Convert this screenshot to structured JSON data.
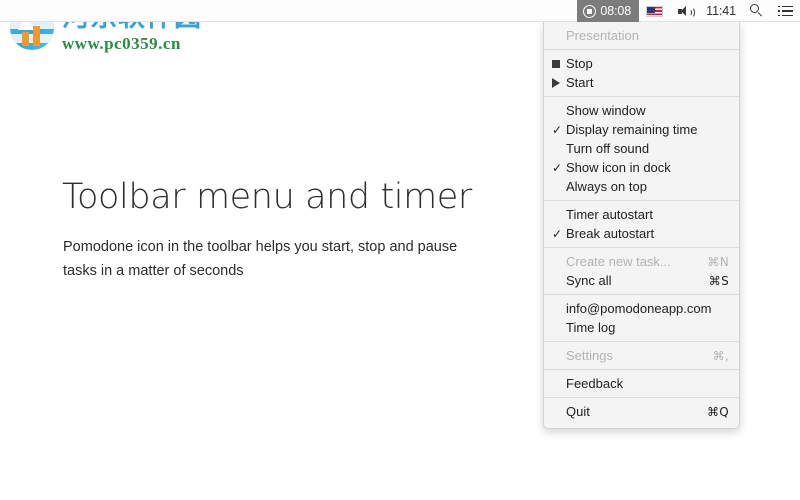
{
  "menubar": {
    "pomodone": {
      "icon": "pomodone-timer-icon",
      "time": "08:08"
    },
    "language_flag": "us-flag-icon",
    "volume_icon": "speaker-icon",
    "clock": "11:41",
    "search_icon": "search-icon",
    "control_center_icon": "list-menu-icon"
  },
  "watermark": {
    "site_name": "河东软件园",
    "url": "www.pc0359.cn"
  },
  "content": {
    "headline": "Toolbar menu and timer",
    "subline": "Pomodone icon in the toolbar helps you start, stop and pause tasks in a matter of seconds"
  },
  "dropdown": {
    "groups": [
      {
        "items": [
          {
            "label": "Presentation",
            "mark": "",
            "glyph": "",
            "shortcut": "",
            "disabled": true
          }
        ]
      },
      {
        "items": [
          {
            "label": "Stop",
            "mark": "",
            "glyph": "square",
            "shortcut": "",
            "disabled": false
          },
          {
            "label": "Start",
            "mark": "",
            "glyph": "triangle",
            "shortcut": "",
            "disabled": false
          }
        ]
      },
      {
        "items": [
          {
            "label": "Show window",
            "mark": "",
            "glyph": "",
            "shortcut": "",
            "disabled": false
          },
          {
            "label": "Display remaining time",
            "mark": "✓",
            "glyph": "",
            "shortcut": "",
            "disabled": false
          },
          {
            "label": "Turn off sound",
            "mark": "",
            "glyph": "",
            "shortcut": "",
            "disabled": false
          },
          {
            "label": "Show icon in dock",
            "mark": "✓",
            "glyph": "",
            "shortcut": "",
            "disabled": false
          },
          {
            "label": "Always on top",
            "mark": "",
            "glyph": "",
            "shortcut": "",
            "disabled": false
          }
        ]
      },
      {
        "items": [
          {
            "label": "Timer autostart",
            "mark": "",
            "glyph": "",
            "shortcut": "",
            "disabled": false
          },
          {
            "label": "Break autostart",
            "mark": "✓",
            "glyph": "",
            "shortcut": "",
            "disabled": false
          }
        ]
      },
      {
        "items": [
          {
            "label": "Create new task...",
            "mark": "",
            "glyph": "",
            "shortcut": "⌘N",
            "disabled": true
          },
          {
            "label": "Sync all",
            "mark": "",
            "glyph": "",
            "shortcut": "⌘S",
            "disabled": false
          }
        ]
      },
      {
        "items": [
          {
            "label": "info@pomodoneapp.com",
            "mark": "",
            "glyph": "",
            "shortcut": "",
            "disabled": false
          },
          {
            "label": "Time log",
            "mark": "",
            "glyph": "",
            "shortcut": "",
            "disabled": false
          }
        ]
      },
      {
        "items": [
          {
            "label": "Settings",
            "mark": "",
            "glyph": "",
            "shortcut": "⌘,",
            "disabled": true
          }
        ]
      },
      {
        "items": [
          {
            "label": "Feedback",
            "mark": "",
            "glyph": "",
            "shortcut": "",
            "disabled": false
          }
        ]
      },
      {
        "items": [
          {
            "label": "Quit",
            "mark": "",
            "glyph": "",
            "shortcut": "⌘Q",
            "disabled": false
          }
        ]
      }
    ]
  },
  "colors": {
    "menu_bg": "#f4f4f4",
    "active_menubar_item": "#7c7c7c",
    "brand_blue": "#2f9fdc",
    "brand_orange": "#f0962a",
    "url_green": "#1f8c3a"
  }
}
